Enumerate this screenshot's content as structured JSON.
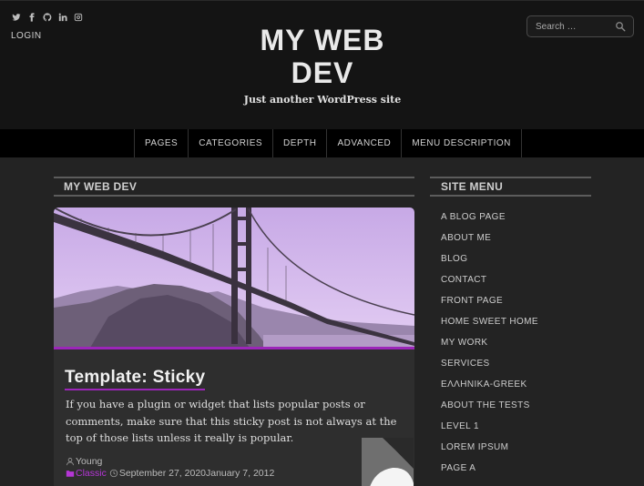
{
  "header": {
    "social_icons": [
      "twitter-icon",
      "facebook-icon",
      "github-icon",
      "linkedin-icon",
      "instagram-icon"
    ],
    "login_label": "LOGIN",
    "site_title_line1": "MY WEB",
    "site_title_line2": "DEV",
    "tagline": "Just another WordPress site",
    "search": {
      "placeholder": "Search …",
      "icon": "search-icon"
    }
  },
  "nav": {
    "items": [
      "PAGES",
      "CATEGORIES",
      "DEPTH",
      "ADVANCED",
      "MENU DESCRIPTION"
    ]
  },
  "main": {
    "heading": "MY WEB DEV",
    "post": {
      "title": "Template: Sticky",
      "excerpt": "If you have a plugin or widget that lists popular posts or comments, make sure that this sticky post is not always at the top of those lists unless it really is popular.",
      "author": "Young",
      "category": "Classic",
      "date": "September 27, 2020January 7, 2012"
    }
  },
  "sidebar": {
    "heading": "SITE MENU",
    "items": [
      "A BLOG PAGE",
      "ABOUT ME",
      "BLOG",
      "CONTACT",
      "FRONT PAGE",
      "HOME SWEET HOME",
      "MY WORK",
      "SERVICES",
      "ΕΛΛΗΝΙΚΑ-GREEK",
      "ABOUT THE TESTS",
      "LEVEL 1",
      "LOREM IPSUM",
      "PAGE A"
    ]
  },
  "colors": {
    "accent": "#9c25b9",
    "category": "#b536d6",
    "background": "#232323",
    "header": "#141414",
    "nav": "#000000"
  }
}
